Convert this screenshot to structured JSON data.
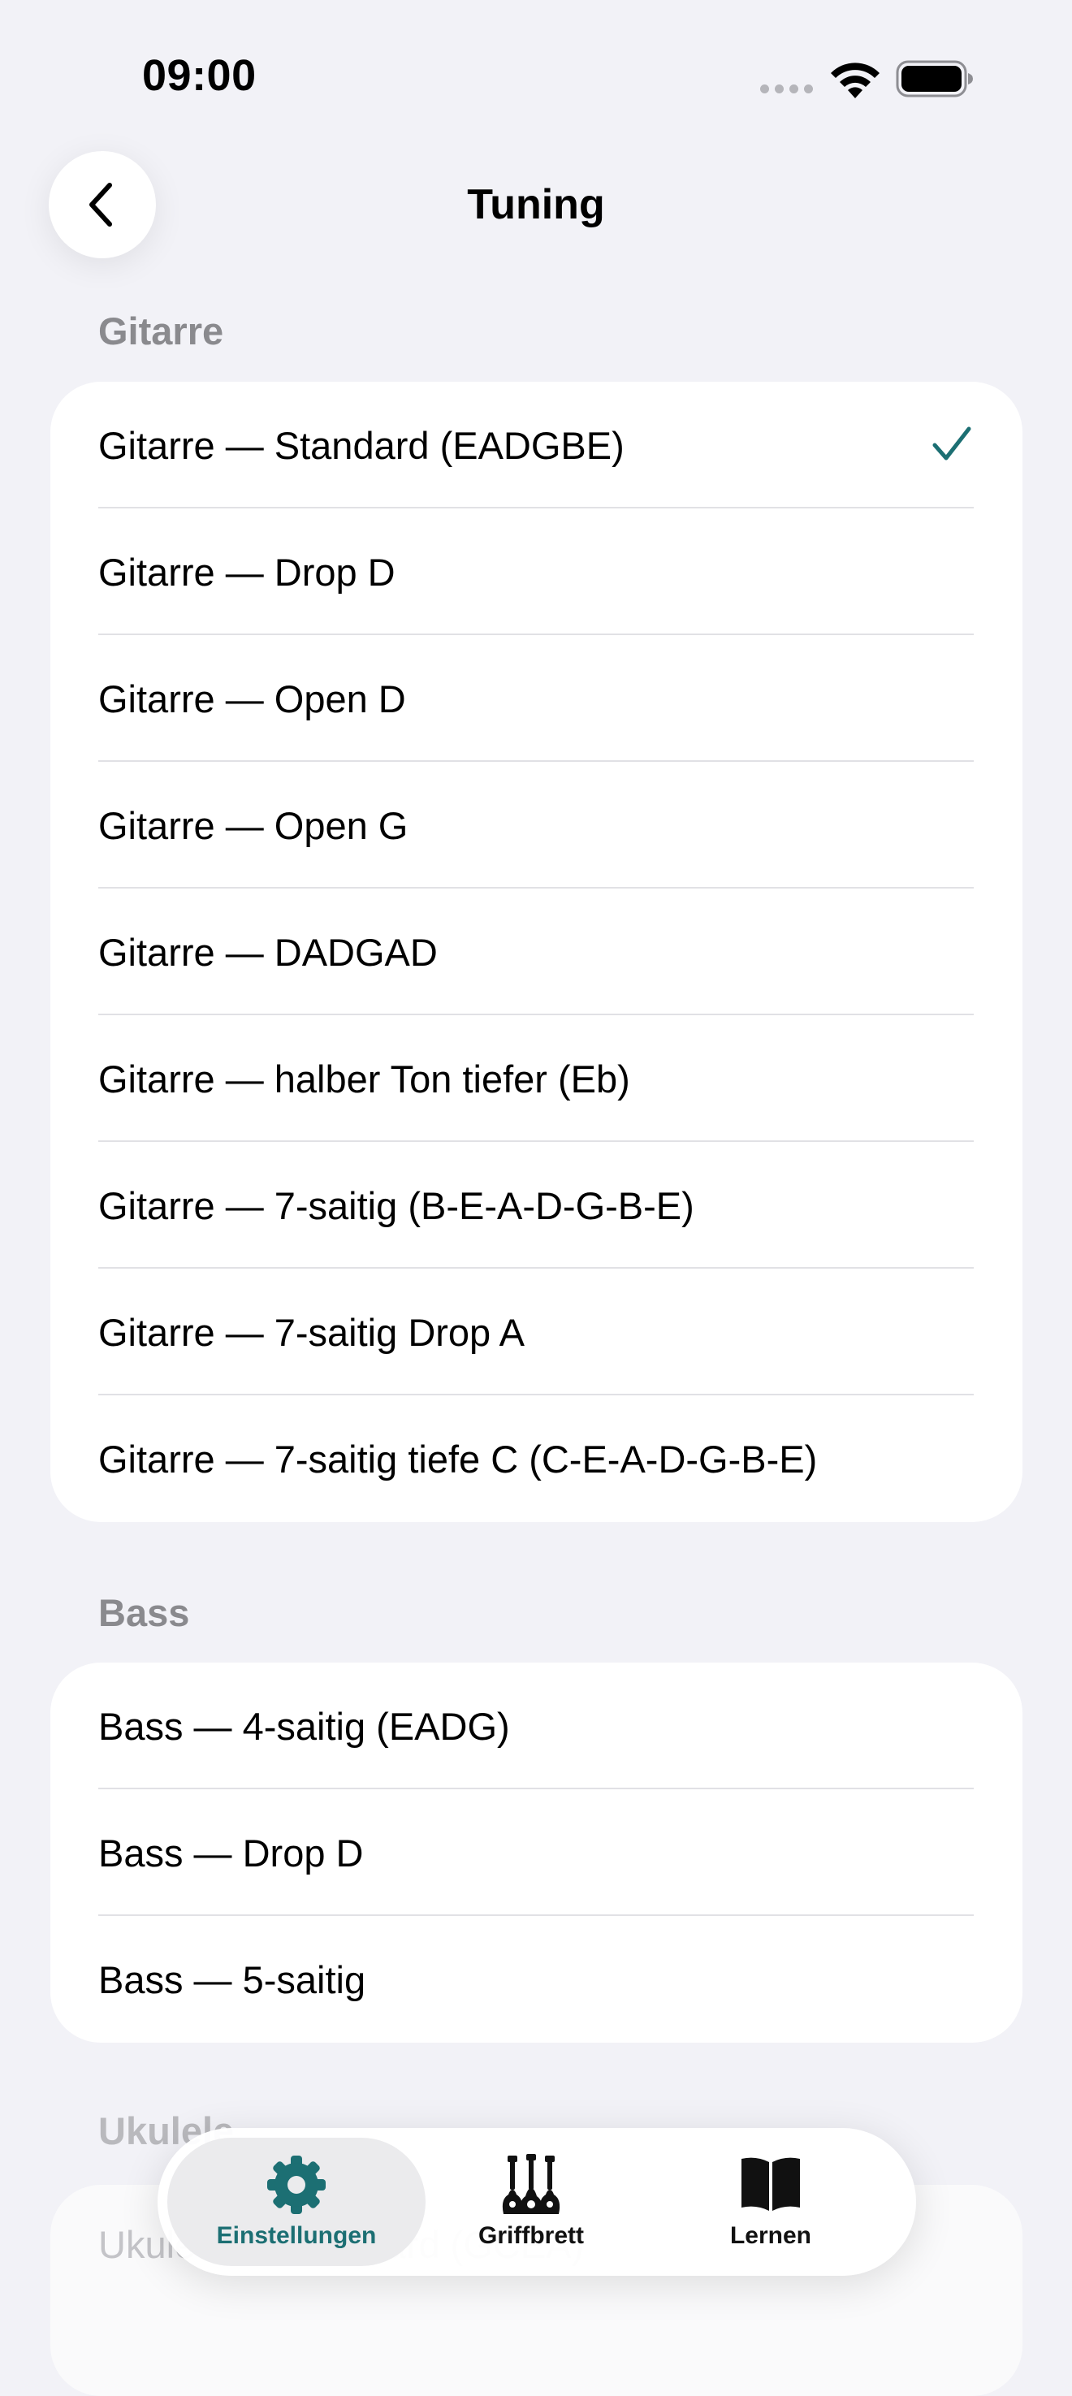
{
  "status_bar": {
    "time": "09:00"
  },
  "nav": {
    "title": "Tuning"
  },
  "sections": [
    {
      "header": "Gitarre",
      "items": [
        {
          "label": "Gitarre — Standard (EADGBE)",
          "selected": true
        },
        {
          "label": "Gitarre — Drop D",
          "selected": false
        },
        {
          "label": "Gitarre — Open D",
          "selected": false
        },
        {
          "label": "Gitarre — Open G",
          "selected": false
        },
        {
          "label": "Gitarre — DADGAD",
          "selected": false
        },
        {
          "label": "Gitarre — halber Ton tiefer (Eb)",
          "selected": false
        },
        {
          "label": "Gitarre — 7-saitig (B-E-A-D-G-B-E)",
          "selected": false
        },
        {
          "label": "Gitarre — 7-saitig Drop A",
          "selected": false
        },
        {
          "label": "Gitarre — 7-saitig tiefe C (C-E-A-D-G-B-E)",
          "selected": false
        }
      ]
    },
    {
      "header": "Bass",
      "items": [
        {
          "label": "Bass — 4-saitig (EADG)",
          "selected": false
        },
        {
          "label": "Bass — Drop D",
          "selected": false
        },
        {
          "label": "Bass — 5-saitig",
          "selected": false
        }
      ]
    },
    {
      "header": "Ukulele",
      "items": [
        {
          "label": "Ukulele — Standard (GCEA)",
          "selected": false
        }
      ]
    }
  ],
  "tab_bar": {
    "tabs": [
      {
        "label": "Einstellungen",
        "icon": "gear-icon",
        "active": true
      },
      {
        "label": "Griffbrett",
        "icon": "instruments-icon",
        "active": false
      },
      {
        "label": "Lernen",
        "icon": "book-icon",
        "active": false
      }
    ]
  },
  "colors": {
    "accent": "#1c6f73",
    "background": "#f2f2f7",
    "card": "#ffffff",
    "section_header": "#8a8a8e"
  }
}
